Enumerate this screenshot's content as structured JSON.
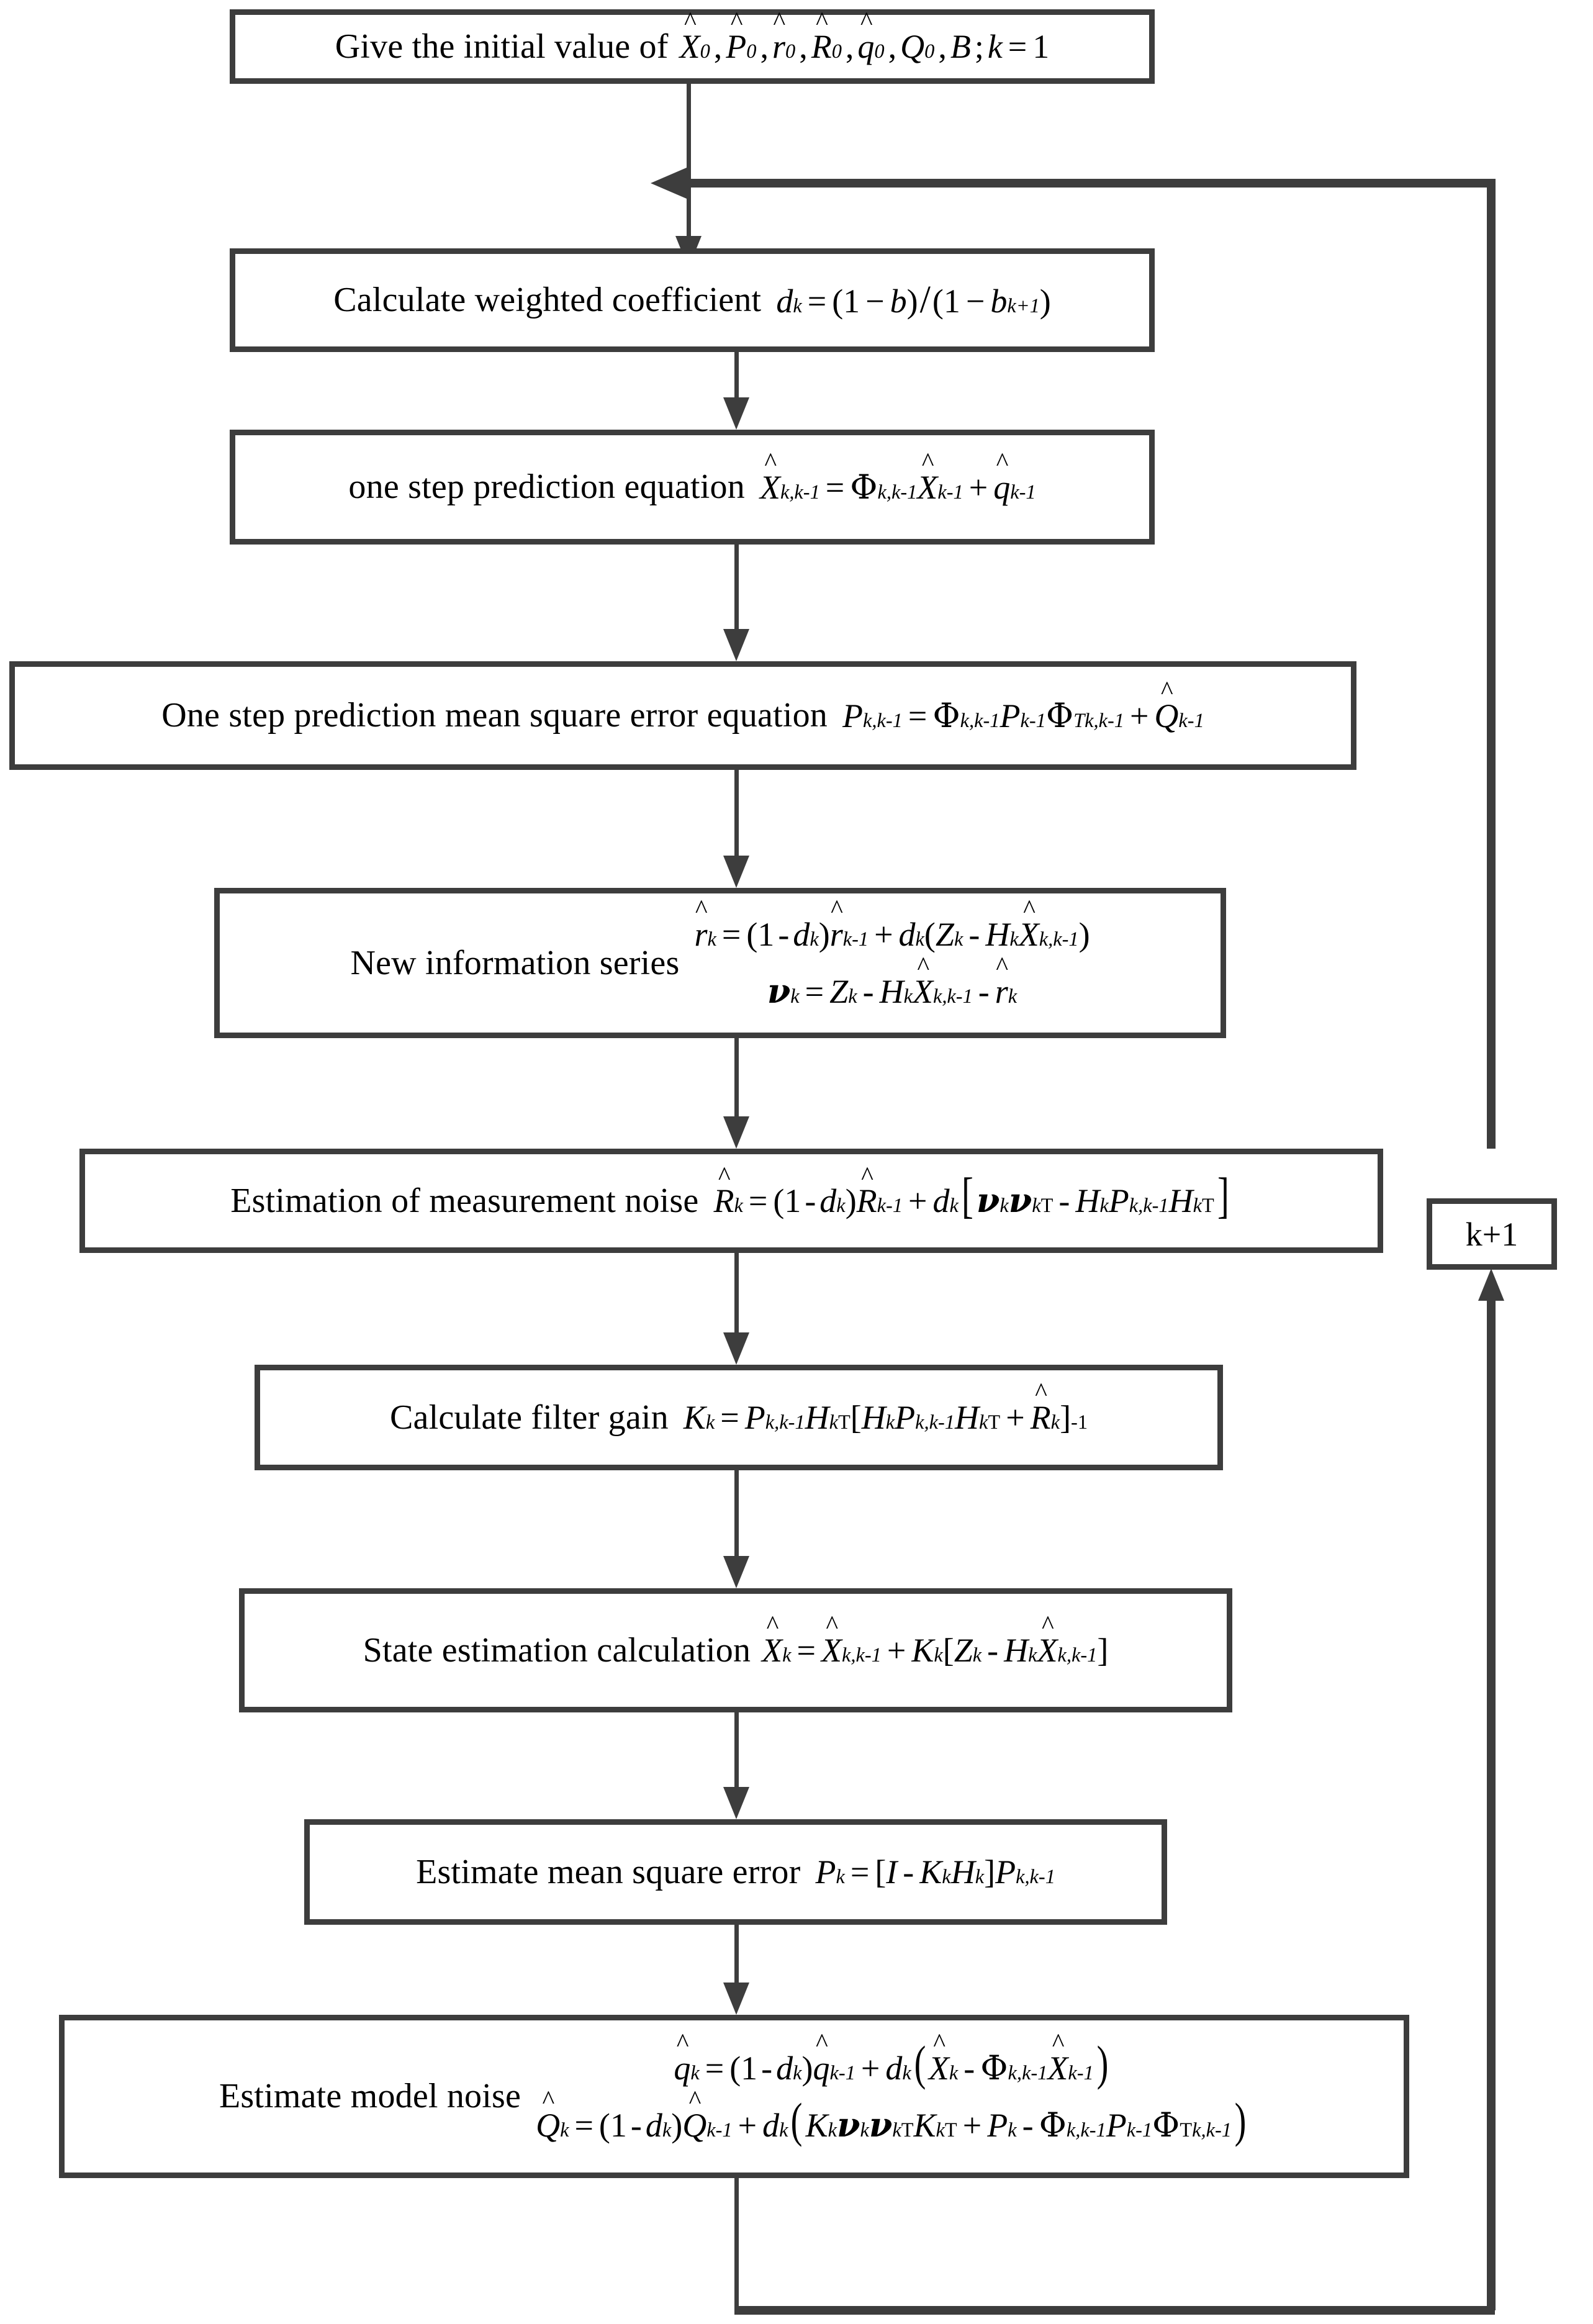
{
  "diagram": {
    "title": "Adaptive Kalman filter algorithm flowchart",
    "line_color": "#3d3d3d",
    "background": "#ffffff"
  },
  "nodes": [
    {
      "id": "init",
      "label": "Give the initial value of",
      "equation_plain": "X̂0, P̂0, r̂0, R̂0, q̂0, Q0, B; k = 1"
    },
    {
      "id": "weighted-coefficient",
      "label": "Calculate weighted coefficient",
      "equation_plain": "dk = (1 − b)/(1 − b^(k+1))"
    },
    {
      "id": "one-step-prediction",
      "label": "one step prediction equation",
      "equation_plain": "X̂k,k-1 = Φk,k-1 X̂k-1 + q̂k-1"
    },
    {
      "id": "one-step-mse",
      "label": "One step prediction mean square error equation",
      "equation_plain": "Pk,k-1 = Φk,k-1 Pk-1 Φ^T k,k-1 + Q̂k-1"
    },
    {
      "id": "new-information-series",
      "label": "New information series",
      "equation_line1_plain": "r̂k = (1 - dk) r̂k-1 + dk (Zk - Hk X̂k,k-1)",
      "equation_line2_plain": "νk = Zk - Hk X̂k,k-1 - r̂k"
    },
    {
      "id": "measurement-noise-estimation",
      "label": "Estimation of measurement noise",
      "equation_plain": "R̂k = (1 - dk) R̂k-1 + dk [ νk νk^T - Hk Pk,k-1 Hk^T ]"
    },
    {
      "id": "filter-gain",
      "label": "Calculate filter gain",
      "equation_plain": "Kk = Pk,k-1 Hk^T [ Hk Pk,k-1 Hk^T + R̂k ]^-1"
    },
    {
      "id": "state-estimation",
      "label": "State estimation calculation",
      "equation_plain": "X̂k = X̂k,k-1 + Kk [ Zk - Hk X̂k,k-1 ]"
    },
    {
      "id": "estimate-mse",
      "label": "Estimate mean square error",
      "equation_plain": "Pk = [ I - Kk Hk ] Pk,k-1"
    },
    {
      "id": "model-noise",
      "label": "Estimate model noise",
      "equation_line1_plain": "q̂k = (1 - dk) q̂k-1 + dk ( X̂k - Φk,k-1 X̂k-1 )",
      "equation_line2_plain": "Q̂k = (1 - dk) Q̂k-1 + dk ( Kk νk νk^T Kk^T + Pk - Φk,k-1 Pk-1 Φ^T k,k-1 )"
    }
  ],
  "loop": {
    "increment_label": "k+1",
    "description": "feedback from Estimate model noise back to Calculate weighted coefficient"
  },
  "symbols": {
    "hat": "ˆ",
    "phi": "Φ",
    "nu": "ν",
    "minus": "-",
    "equals": "=",
    "plus": "+"
  }
}
